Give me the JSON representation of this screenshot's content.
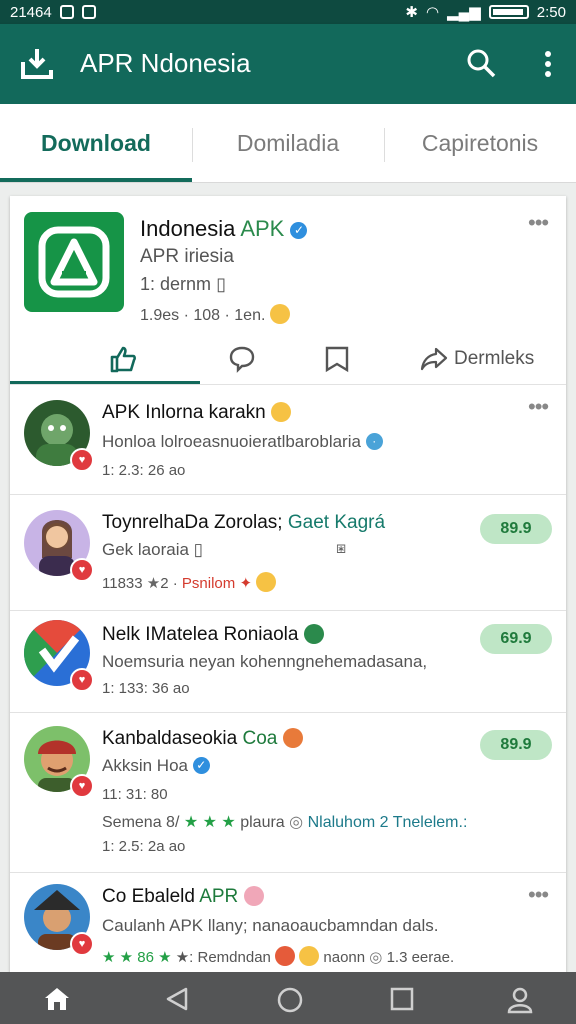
{
  "status": {
    "time_left": "21464",
    "time_right": "2:50"
  },
  "app_bar": {
    "title": "APR Ndonesia"
  },
  "tabs": [
    "Download",
    "Domiladia",
    "Capiretonis"
  ],
  "featured": {
    "name": "Indonesia",
    "name_accent": "APK",
    "line1": "APR iriesia",
    "line2": "1: dernm",
    "line3": "1.9es · 108 · 1en.",
    "actions": {
      "share_label": "Dermleks"
    }
  },
  "rows": [
    {
      "title": "APK Inlorna karakn",
      "desc": "Honloa lolroeasnuoieratlbaroblaria",
      "meta": "1: 2.3: 26 ao"
    },
    {
      "title": "ToynrelhaDa Zorolas;",
      "title_accent": "Gaet Kagrá",
      "desc": "Gek laoraia",
      "meta": "11833",
      "meta_tail": "2 ·",
      "meta_red": "Psnilom",
      "pill": "89.9"
    },
    {
      "title": "Nelk IMatelea Roniaola",
      "desc": "Noemsuria neyan kohenngnehemadasana,",
      "meta": "1: 133: 36 ao",
      "pill": "69.9"
    },
    {
      "title": "Kanbaldaseokia",
      "title_accent": "Coa",
      "desc": "Akksin Hoa",
      "meta": "11: 31: 80",
      "extra1_a": "Semena 8/",
      "extra1_b": "plaura",
      "extra1_c": "Nlaluhom",
      "extra1_d": "2",
      "extra1_e": "Tnelelem.:",
      "extra2": "1: 2.5: 2a ao",
      "pill": "89.9"
    },
    {
      "title": "Co Ebaleld",
      "title_accent": "APR",
      "desc": "Caulanh APK llany; nanaoaucbamndan dals.",
      "meta_a": "86",
      "meta_b": ": Remdndan",
      "meta_c": "naonn",
      "meta_d": "1.3 eerae."
    }
  ]
}
